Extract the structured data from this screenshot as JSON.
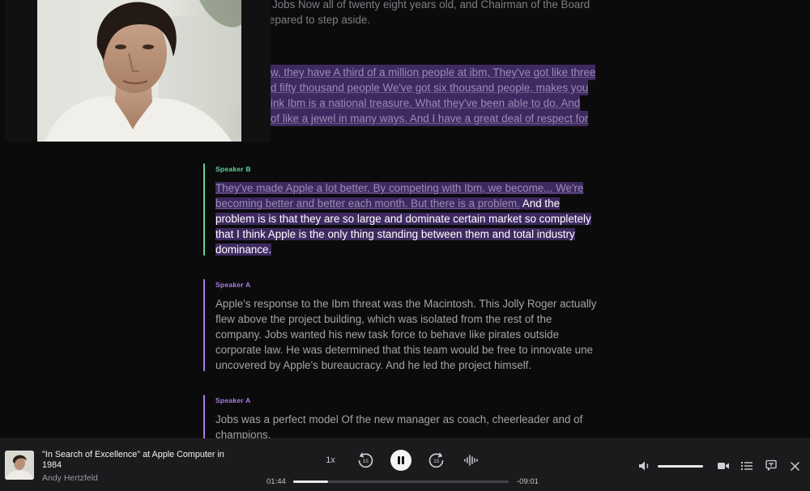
{
  "transcript": {
    "top_para": {
      "line1": "Jobs Now all of twenty eight years old, and Chairman of the Board",
      "line2": "epared to step aside."
    },
    "highlight_para": {
      "line1": "w, they have A third of a million people at ibm, They've got like three",
      "line2": "d fifty thousand people We've got six thousand people, makes you",
      "line3": "ink Ibm is a national treasure. What they've been able to do. And",
      "line4": "of like a jewel in many ways. And I have a great deal of respect for"
    },
    "blocks": [
      {
        "speaker": "Speaker B",
        "played": "They've made Apple a lot better. By competing with Ibm, we become... We're becoming better and better each month. But there is a problem.",
        "active": " And the problem is is that they are so large and dominate certain market so completely that I think Apple is the only thing standing between them and total industry dominance."
      },
      {
        "speaker": "Speaker A",
        "text": "Apple's response to the Ibm threat was the Macintosh. This Jolly Roger actually flew above the project building, which was isolated from the rest of the company. Jobs wanted his new task force to behave like pirates outside corporate law. He was determined that this team would be free to innovate une uncovered by Apple's bureaucracy. And he led the project himself."
      },
      {
        "speaker": "Speaker A",
        "text": "Jobs was a perfect model Of the new manager as coach, cheerleader and of champions."
      }
    ]
  },
  "player": {
    "episode_title": "\"In Search of Excellence\" at Apple Computer in 1984",
    "author": "Andy Hertzfeld",
    "speed": "1x",
    "skip_back_seconds": "15",
    "skip_forward_seconds": "15",
    "elapsed": "01:44",
    "remaining": "-09:01",
    "progress_fraction": 0.16,
    "volume_fraction": 1.0
  },
  "colors": {
    "speaker_a": "#a97be8",
    "speaker_b": "#62d29a",
    "highlight_bg": "#3e2a60"
  }
}
